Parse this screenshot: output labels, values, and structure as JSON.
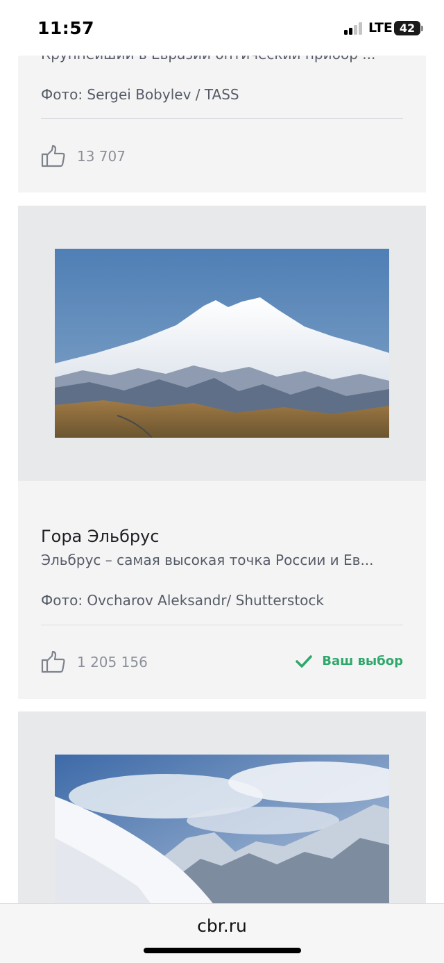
{
  "status_bar": {
    "time": "11:57",
    "network": "LTE",
    "battery": "42"
  },
  "cards": [
    {
      "description": "Крупнейший в Евразии оптический прибор ...",
      "credit": "Фото: Sergei Bobylev / TASS",
      "likes": "13 707"
    },
    {
      "title": "Гора Эльбрус",
      "description": "Эльбрус – самая высокая точка России и Ев...",
      "credit": "Фото: Ovcharov Aleksandr/ Shutterstock",
      "likes": "1 205 156",
      "choice_label": "Ваш выбор"
    },
    {
      "image": "snowy-mountains-photo"
    }
  ],
  "browser": {
    "url": "cbr.ru"
  },
  "icons": {
    "like": "thumbs-up-icon",
    "choice": "checkmark-icon"
  },
  "colors": {
    "accent_green": "#2ea86a",
    "card_bg": "#f4f4f5",
    "image_bg": "#e8e9eb"
  }
}
